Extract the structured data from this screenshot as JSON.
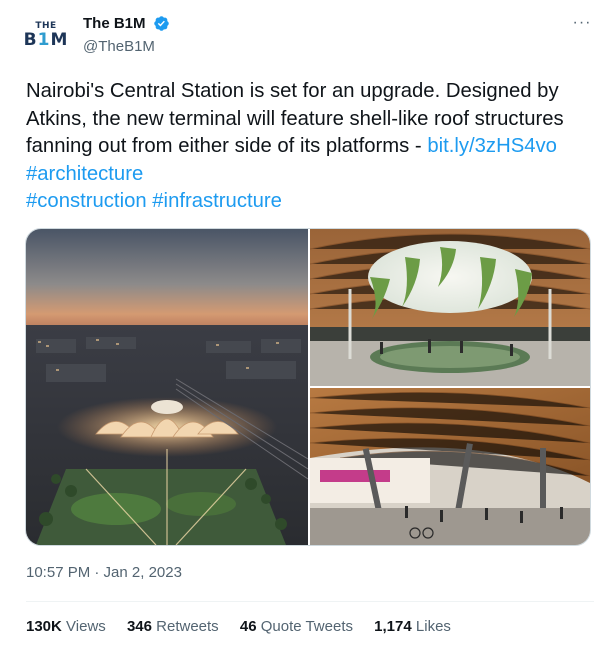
{
  "author": {
    "avatar_top": "THE",
    "avatar_main_a": "B",
    "avatar_main_b": "1",
    "avatar_main_c": "M",
    "display_name": "The B1M",
    "handle": "@TheB1M",
    "verified": true,
    "verified_color": "#1d9bf0"
  },
  "more_button": {
    "icon": "more-horizontal-icon",
    "glyph": "···"
  },
  "tweet": {
    "text_part1": "Nairobi's Central Station is set for an upgrade. Designed by Atkins, the new terminal will feature shell-like roof structures fanning out from either side of its platforms - ",
    "link": "bit.ly/3zHS4vo",
    "hashtag1": "#architecture",
    "hashtag2": "#construction",
    "hashtag3": "#infrastructure",
    "link_color": "#1d9bf0"
  },
  "media": {
    "images": [
      {
        "subject": "aerial-dusk-station-render"
      },
      {
        "subject": "station-interior-oculus-render"
      },
      {
        "subject": "platform-timber-roof-render"
      }
    ]
  },
  "timestamp": "10:57 PM · Jan 2, 2023",
  "stats": {
    "views_num": "130K",
    "views_label": "Views",
    "retweets_num": "346",
    "retweets_label": "Retweets",
    "quotes_num": "46",
    "quotes_label": "Quote Tweets",
    "likes_num": "1,174",
    "likes_label": "Likes"
  }
}
